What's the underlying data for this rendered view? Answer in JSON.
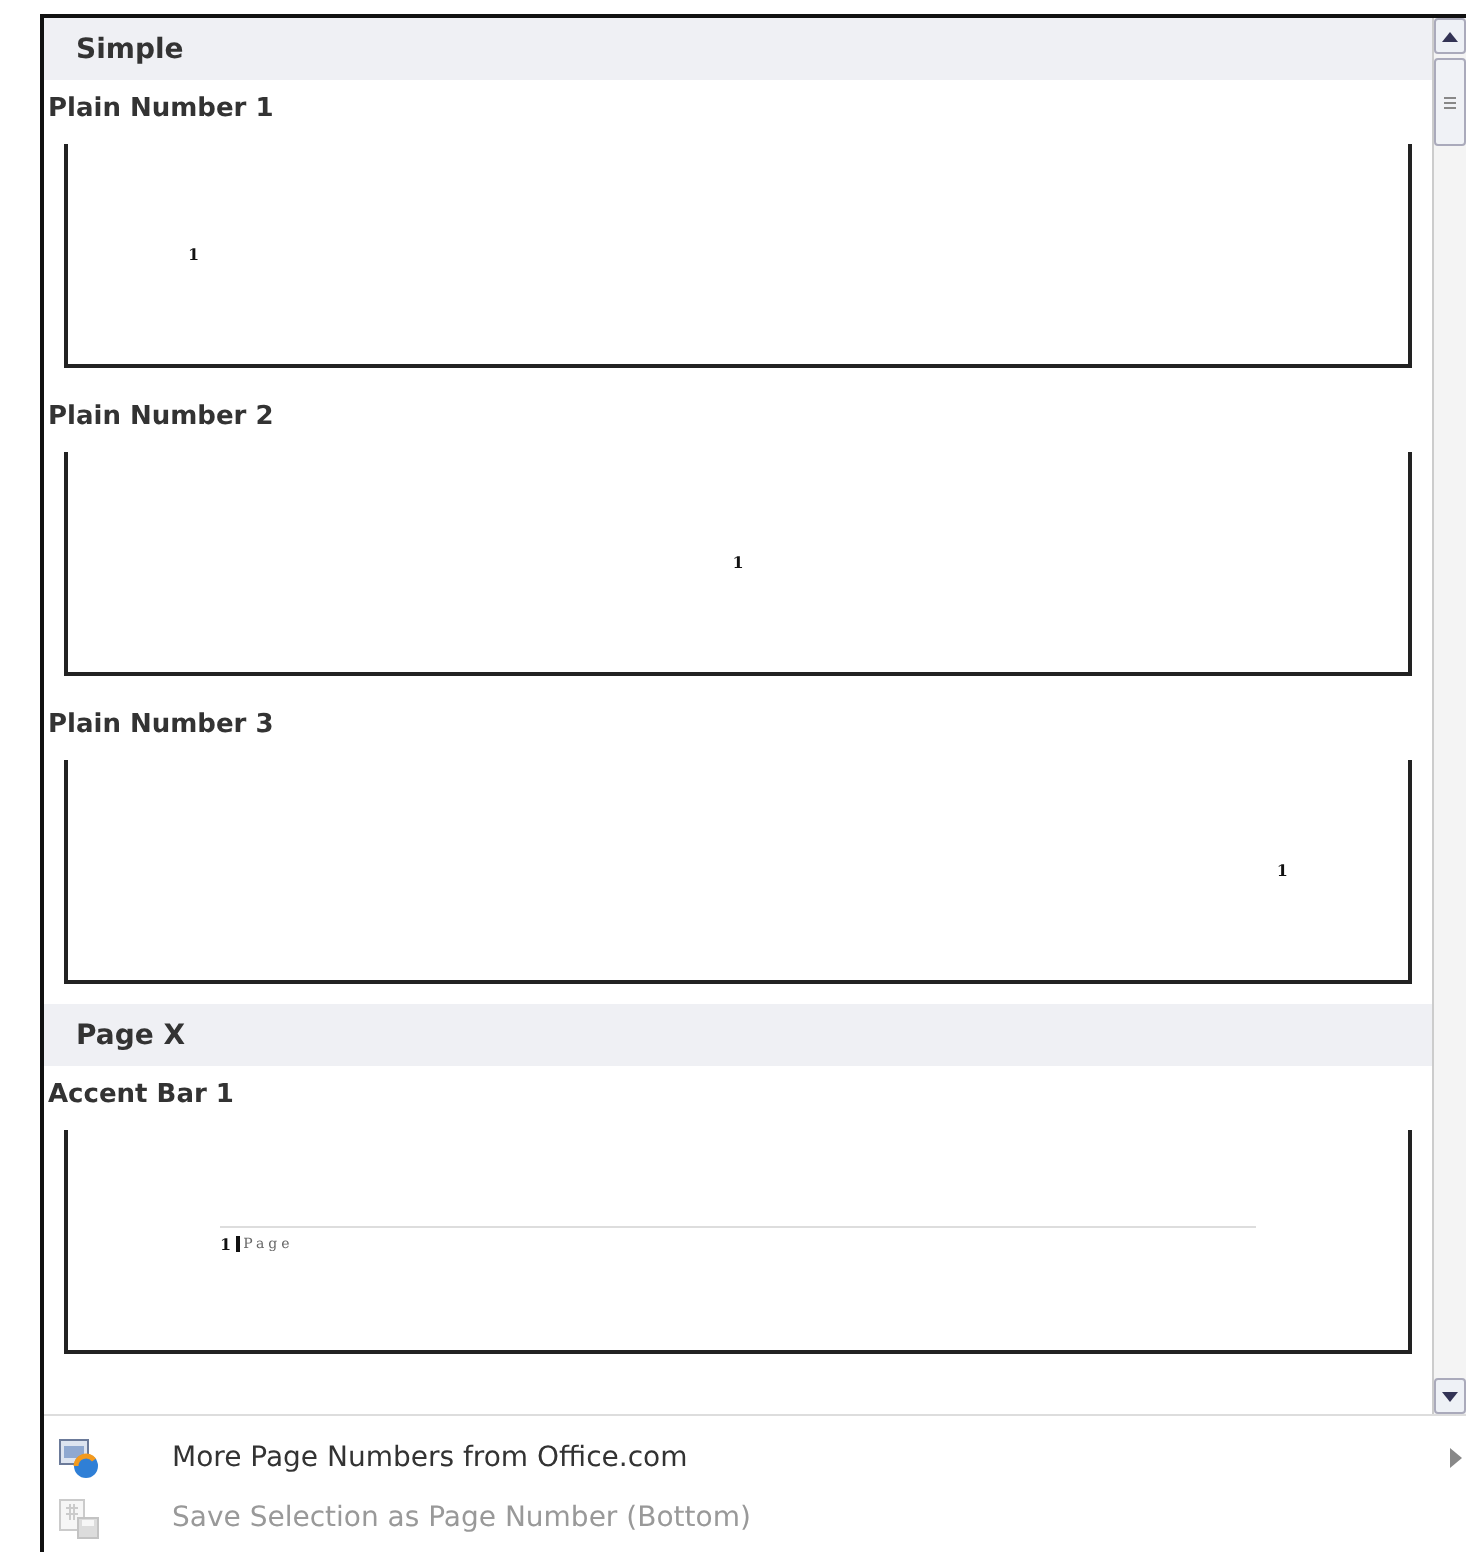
{
  "groups": [
    {
      "title": "Simple",
      "items": [
        {
          "title": "Plain Number 1",
          "kind": "left",
          "sample": "1"
        },
        {
          "title": "Plain Number 2",
          "kind": "center",
          "sample": "1"
        },
        {
          "title": "Plain Number 3",
          "kind": "right",
          "sample": "1"
        }
      ]
    },
    {
      "title": "Page X",
      "items": [
        {
          "title": "Accent Bar 1",
          "kind": "accent-bar",
          "sample": "1",
          "sample_label": "Page"
        }
      ]
    }
  ],
  "menu": [
    {
      "label": "More Page Numbers from Office.com",
      "disabled": false,
      "submenu": true
    },
    {
      "label": "Save Selection as Page Number (Bottom)",
      "disabled": true,
      "submenu": false
    }
  ]
}
